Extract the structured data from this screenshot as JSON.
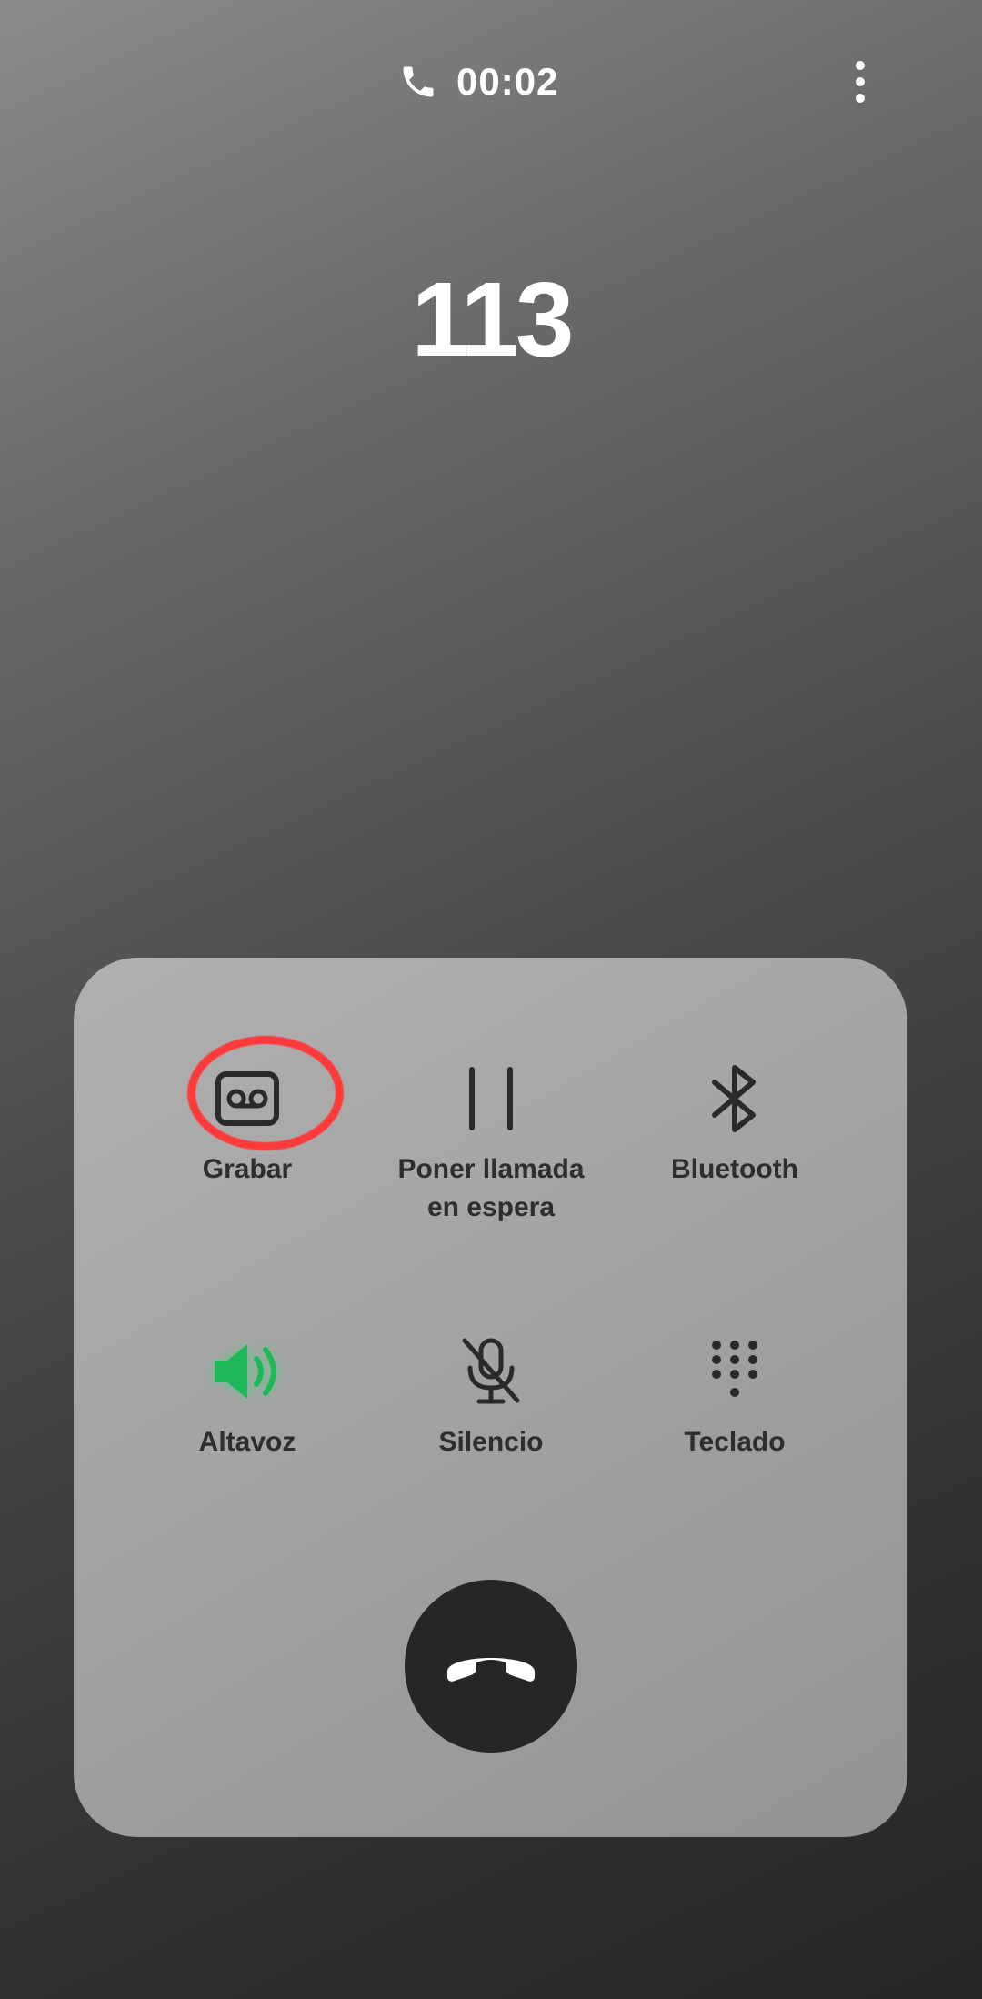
{
  "header": {
    "call_duration": "00:02",
    "phone_icon": "phone-icon",
    "more_icon": "more-vertical-icon"
  },
  "caller": {
    "number": "113"
  },
  "controls": {
    "record": {
      "label": "Grabar",
      "icon": "voicemail-record-icon",
      "highlighted": true,
      "highlight_color": "#ff3a3a"
    },
    "hold": {
      "label": "Poner llamada\nen espera",
      "icon": "pause-icon"
    },
    "bluetooth": {
      "label": "Bluetooth",
      "icon": "bluetooth-icon"
    },
    "speaker": {
      "label": "Altavoz",
      "icon": "speaker-icon",
      "active": true,
      "active_color": "#1fb85a"
    },
    "mute": {
      "label": "Silencio",
      "icon": "mic-off-icon"
    },
    "keypad": {
      "label": "Teclado",
      "icon": "keypad-icon"
    }
  },
  "end_call": {
    "icon": "end-call-icon",
    "color": "#262626"
  }
}
